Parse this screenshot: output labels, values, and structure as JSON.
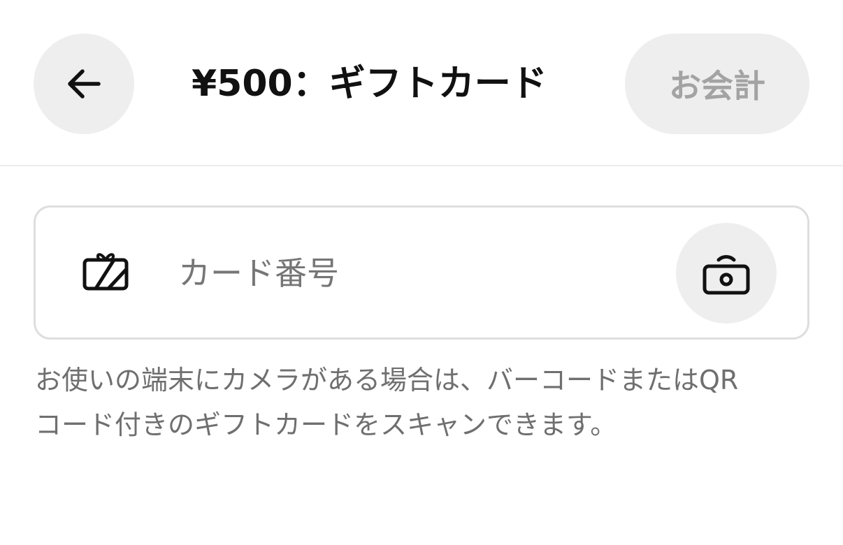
{
  "header": {
    "back_icon": "arrow-left-icon",
    "title": "¥500：ギフトカード",
    "checkout_label": "お会計"
  },
  "card_field": {
    "gift_icon": "gift-card-icon",
    "value": "",
    "placeholder": "カード番号",
    "scan_icon": "camera-scan-icon"
  },
  "help": {
    "text": "お使いの端末にカメラがある場合は、バーコードまたはQR\nコード付きのギフトカードをスキャンできます。"
  },
  "colors": {
    "button_background": "#eeeeee",
    "disabled_text": "#a3a3a3",
    "help_text": "#6f6f6f",
    "field_border": "#dedede"
  }
}
